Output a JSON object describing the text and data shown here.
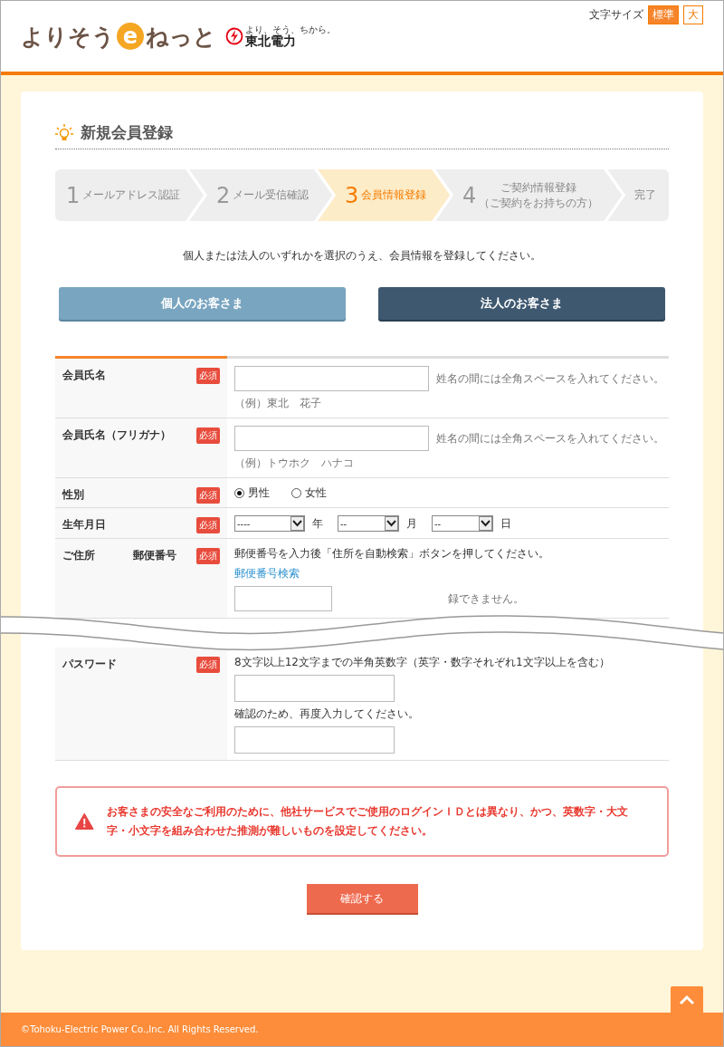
{
  "header": {
    "logo_text": "よりそう",
    "logo_e": "e",
    "logo_text2": "ねっと",
    "brand_tagline": "より、そう、ちから。",
    "brand_name": "東北電力",
    "font_size_label": "文字サイズ",
    "font_sizes": [
      {
        "label": "標準",
        "selected": true
      },
      {
        "label": "大",
        "selected": false
      }
    ]
  },
  "page_title": "新規会員登録",
  "steps": [
    {
      "number": "1",
      "label": "メールアドレス認証",
      "selected": false
    },
    {
      "number": "2",
      "label": "メール受信確認",
      "selected": false
    },
    {
      "number": "3",
      "label": "会員情報登録",
      "selected": true
    },
    {
      "number": "4",
      "label": "ご契約情報登録",
      "note": "（ご契約をお持ちの方）",
      "selected": false
    },
    {
      "label": "完了",
      "selected": false
    }
  ],
  "intro": "個人または法人のいずれかを選択のうえ、会員情報を登録してください。",
  "customer_types": [
    {
      "label": "個人のお客さま",
      "selected": false
    },
    {
      "label": "法人のお客さま",
      "selected": true
    }
  ],
  "form_rows": [
    {
      "kind": "text",
      "label": "会員氏名",
      "required": "必須",
      "hint": "姓名の間には全角スペースを入れてください。",
      "example": "（例）東北　花子"
    },
    {
      "kind": "text",
      "label": "会員氏名（フリガナ）",
      "required": "必須",
      "hint": "姓名の間には全角スペースを入れてください。",
      "example": "（例）トウホク　ハナコ"
    },
    {
      "kind": "radio",
      "label": "性別",
      "required": "必須",
      "options": [
        {
          "label": "男性",
          "selected": true
        },
        {
          "label": "女性",
          "selected": false
        }
      ]
    },
    {
      "kind": "date",
      "label": "生年月日",
      "required": "必須",
      "selects": [
        {
          "value": "----",
          "unit": "年"
        },
        {
          "value": "--",
          "unit": "月"
        },
        {
          "value": "--",
          "unit": "日"
        }
      ]
    },
    {
      "kind": "address",
      "label": "ご住所",
      "sublabel": "郵便番号",
      "required": "必須",
      "instruction": "郵便番号を入力後「住所を自動検索」ボタンを押してください。",
      "link": "郵便番号検索",
      "note": "録できません。"
    },
    {
      "kind": "password",
      "label": "パスワード",
      "required": "必須",
      "instruction": "8文字以上12文字までの半角英数字（英字・数字それぞれ1文字以上を含む）",
      "confirm_label": "確認のため、再度入力してください。"
    }
  ],
  "warning": "お客さまの安全なご利用のために、他社サービスでご使用のログインＩＤとは異なり、かつ、英数字・大文字・小文字を組み合わせた推測が難しいものを設定してください。",
  "confirm_button": "確認する",
  "footer": {
    "copyright": "©Tohoku-Electric Power Co.,Inc. All Rights Reserved."
  }
}
